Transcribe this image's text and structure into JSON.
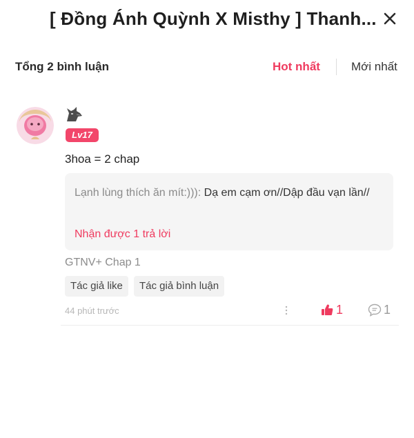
{
  "header": {
    "title": "[ Đồng Ánh Quỳnh X Misthy ] Thanh...",
    "close_icon": "close-icon"
  },
  "summary": {
    "total": "Tổng 2 bình luận",
    "sort_hot": "Hot nhất",
    "sort_new": "Mới nhất",
    "accent_color": "#ef3b5f"
  },
  "comment": {
    "username_icon": "wolf-icon",
    "level": "Lv17",
    "text": "3hoa = 2 chap",
    "reply_preview": {
      "author": "Lạnh lùng thích ăn mít:))):",
      "text": " Dạ em cạm ơn//Dập đầu vạn lần//",
      "count_label": "Nhận được 1 trả lời"
    },
    "chapter": "GTNV+ Chap 1",
    "tags": [
      "Tác giả like",
      "Tác giả bình luận"
    ],
    "time": "44 phút trước",
    "likes": "1",
    "replies": "1"
  }
}
